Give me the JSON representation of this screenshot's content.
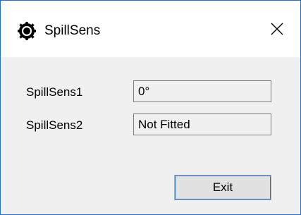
{
  "window": {
    "title": "SpillSens",
    "icon": "gear-app-icon",
    "close_icon": "close-icon"
  },
  "fields": [
    {
      "label": "SpillSens1",
      "value": "0°"
    },
    {
      "label": "SpillSens2",
      "value": "Not Fitted"
    }
  ],
  "buttons": {
    "exit_label": "Exit"
  },
  "colors": {
    "accent": "#2b6cc4",
    "dialog_background": "#f0f0f0",
    "titlebar_background": "#ffffff"
  }
}
